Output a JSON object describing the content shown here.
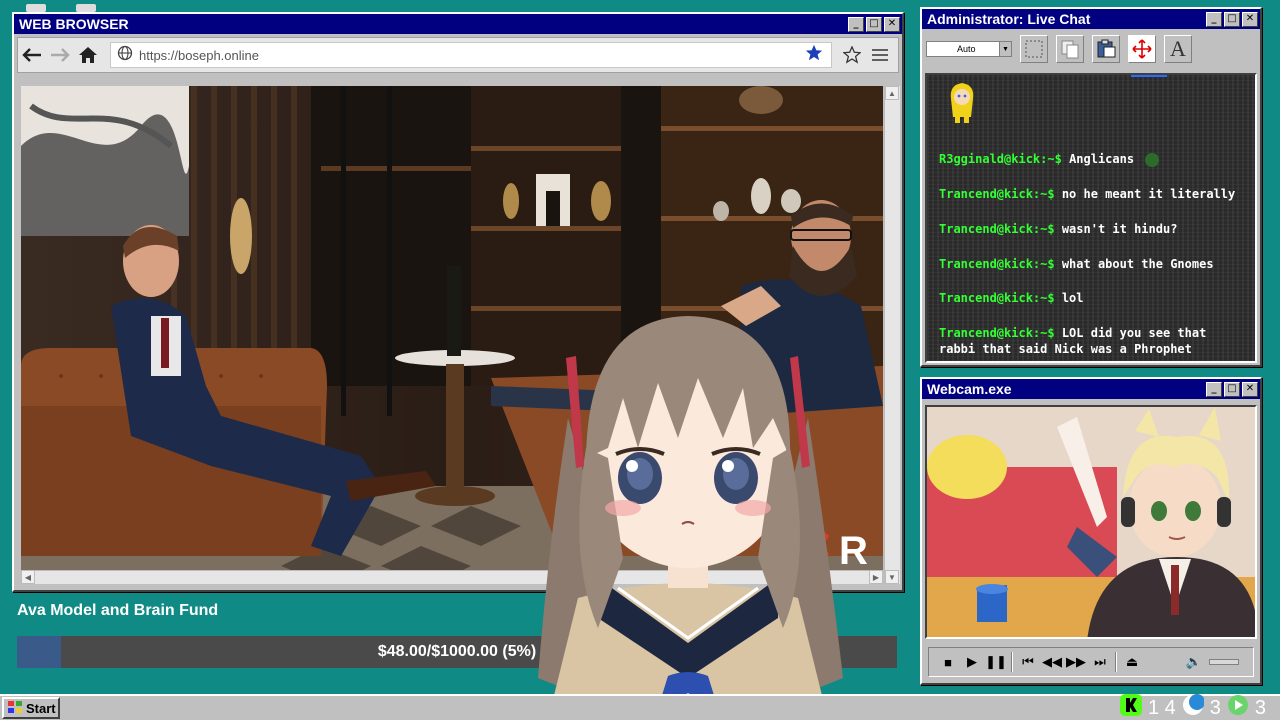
{
  "browser": {
    "title": "WEB BROWSER",
    "url": "https://boseph.online",
    "controls": {
      "minimize": "_",
      "maximize": "□",
      "close": "✕"
    }
  },
  "video": {
    "watermark": "R"
  },
  "chat": {
    "title": "Administrator: Live Chat",
    "font_select": "Auto",
    "messages": [
      {
        "user": "R3gginald@kick:~$",
        "text": "Anglicans"
      },
      {
        "user": "Trancend@kick:~$",
        "text": "no he meant it literally"
      },
      {
        "user": "Trancend@kick:~$",
        "text": "wasn't it hindu?"
      },
      {
        "user": "Trancend@kick:~$",
        "text": "what about the Gnomes"
      },
      {
        "user": "Trancend@kick:~$",
        "text": "lol"
      },
      {
        "user": "Trancend@kick:~$",
        "text": "LOL did you see that rabbi that said Nick was a Phrophet"
      }
    ]
  },
  "webcam": {
    "title": "Webcam.exe"
  },
  "fund": {
    "title": "Ava Model and Brain Fund",
    "progress_text": "$48.00/$1000.00 (5%)",
    "progress_percent": 5
  },
  "taskbar": {
    "start_label": "Start",
    "tray": [
      {
        "icon": "kick-icon",
        "count": "1 4"
      },
      {
        "icon": "moon-icon",
        "count": "3"
      },
      {
        "icon": "play-icon",
        "count": "3"
      }
    ]
  },
  "colors": {
    "desktop": "#0f8a85",
    "titlebar": "#000080",
    "chat_user": "#33ff33",
    "fund_fill": "#3a5a8a"
  }
}
